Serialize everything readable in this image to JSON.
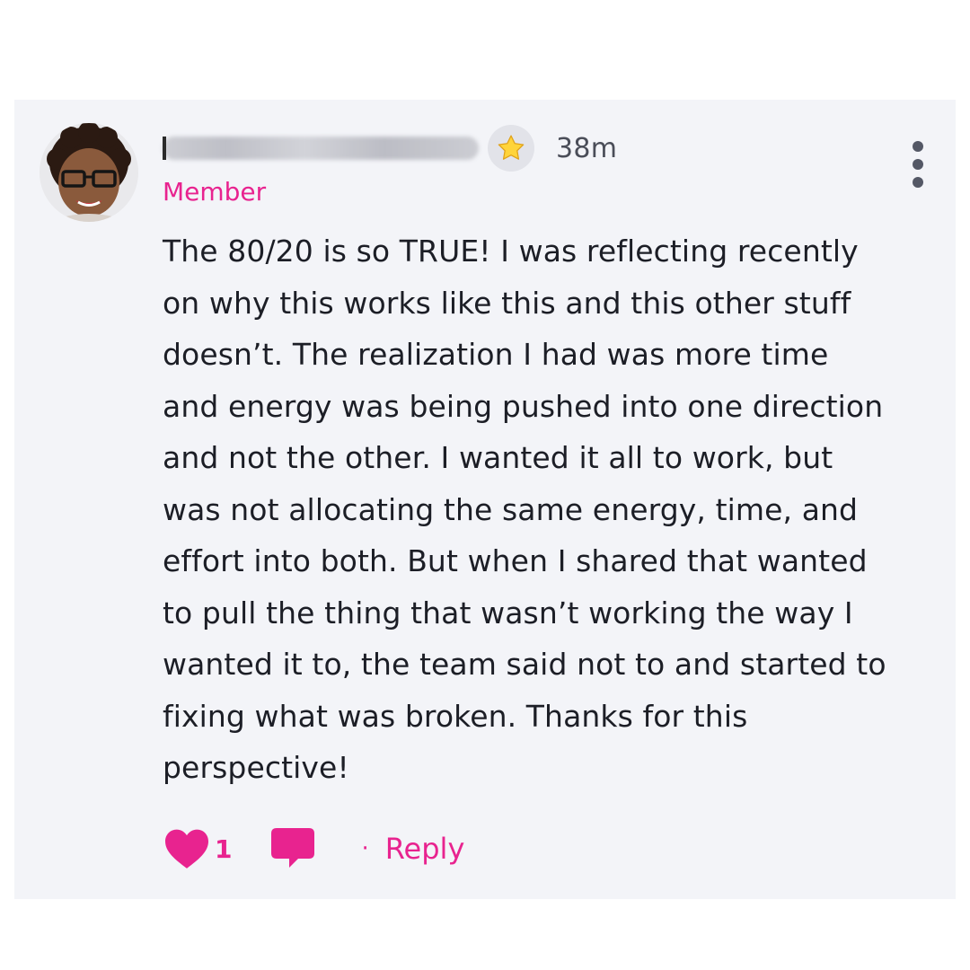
{
  "comment": {
    "author_name": "",
    "role": "Member",
    "time": "38m",
    "body": "The 80/20 is so TRUE! I was reflecting recently\non why this works like this and this other stuff\ndoesn’t. The realization I had was more time\nand energy was being pushed into one direction\nand not the other. I wanted it all to work, but\nwas not allocating the same energy, time, and\neffort into both. But when I shared that wanted\nto pull the thing that wasn’t working the way I\nwanted it to, the team said not to and started to\nfixing what was broken. Thanks for this\nperspective!",
    "badge_icon": "star-icon",
    "more_icon": "vertical-dots-icon"
  },
  "actions": {
    "like_icon": "heart-icon",
    "like_count": "1",
    "comment_icon": "comment-bubble-icon",
    "separator": "·",
    "reply_label": "Reply"
  },
  "colors": {
    "accent": "#e8238f",
    "card_background": "#f3f4f8",
    "text": "#1c1e26",
    "muted_text": "#4a4d58"
  }
}
